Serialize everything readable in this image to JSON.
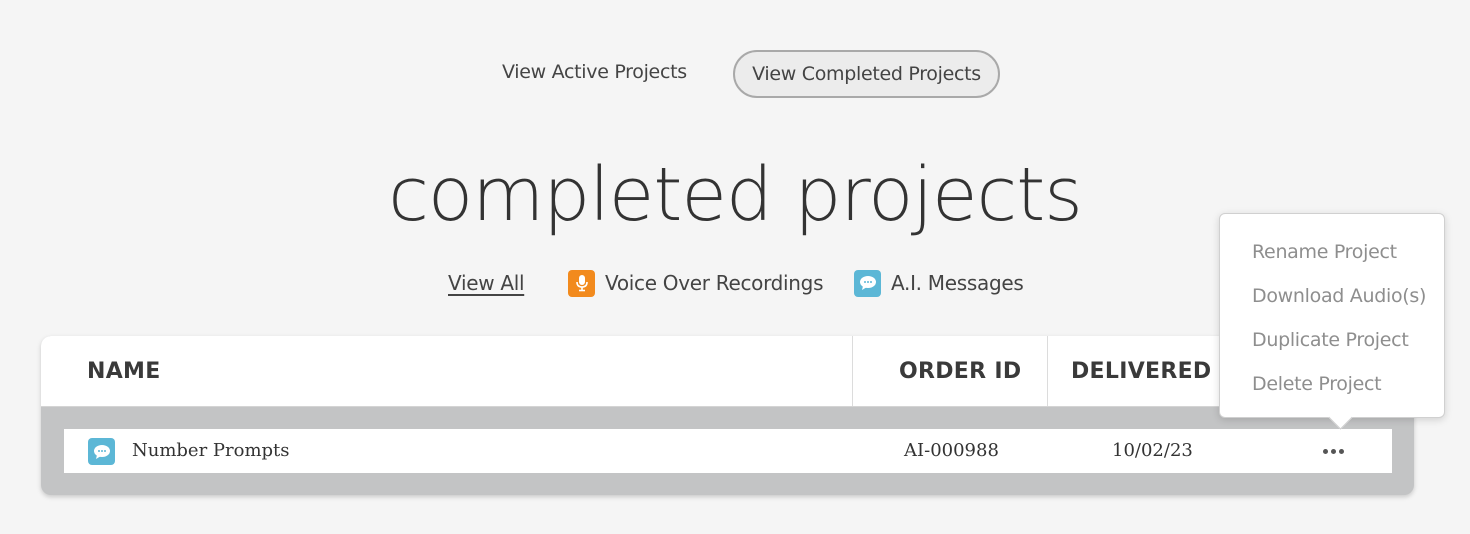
{
  "nav": {
    "active_label": "View Active Projects",
    "completed_label": "View Completed Projects"
  },
  "page": {
    "title": "completed projects"
  },
  "filters": {
    "all": "View All",
    "voice_over": "Voice Over Recordings",
    "ai_messages": "A.I. Messages"
  },
  "icons": {
    "voice_over": "microphone-icon",
    "ai_messages": "chat-bubble-icon",
    "more": "more-dots-icon"
  },
  "colors": {
    "voice_over_icon": "#f28a1d",
    "ai_icon": "#5cb7d6",
    "table_band": "#c3c4c5"
  },
  "table": {
    "headers": {
      "name": "NAME",
      "order_id": "ORDER ID",
      "delivered_on": "DELIVERED ON"
    },
    "rows": [
      {
        "name": "Number Prompts",
        "order_id": "AI-000988",
        "delivered_on": "10/02/23",
        "type": "ai_messages"
      }
    ]
  },
  "menu": {
    "items": [
      "Rename Project",
      "Download Audio(s)",
      "Duplicate Project",
      "Delete Project"
    ]
  }
}
